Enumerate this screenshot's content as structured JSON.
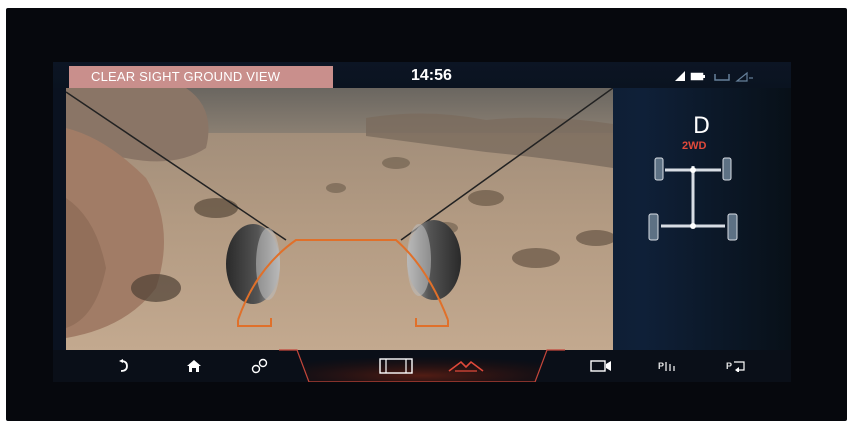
{
  "header": {
    "title": "CLEAR SIGHT GROUND VIEW",
    "time": "14:56",
    "status_icons": [
      "signal-icon",
      "battery-icon",
      "wifi-icon",
      "network-icon"
    ]
  },
  "vehicle": {
    "gear": "D",
    "drive_mode": "2WD",
    "drive_mode_color": "#e0493a"
  },
  "toolbar": {
    "items": [
      {
        "icon": "back-icon"
      },
      {
        "icon": "home-icon"
      },
      {
        "icon": "settings-circles-icon"
      },
      {
        "icon": "split-view-icon"
      },
      {
        "icon": "ground-view-icon",
        "active": true
      },
      {
        "icon": "camera-icon"
      },
      {
        "icon": "park-assist-icon",
        "label": "P"
      },
      {
        "icon": "park-exit-icon",
        "label": "P"
      }
    ]
  },
  "colors": {
    "accent": "#e0493a",
    "title_bar": "#c98f8c",
    "overlay": "#e0702a"
  }
}
